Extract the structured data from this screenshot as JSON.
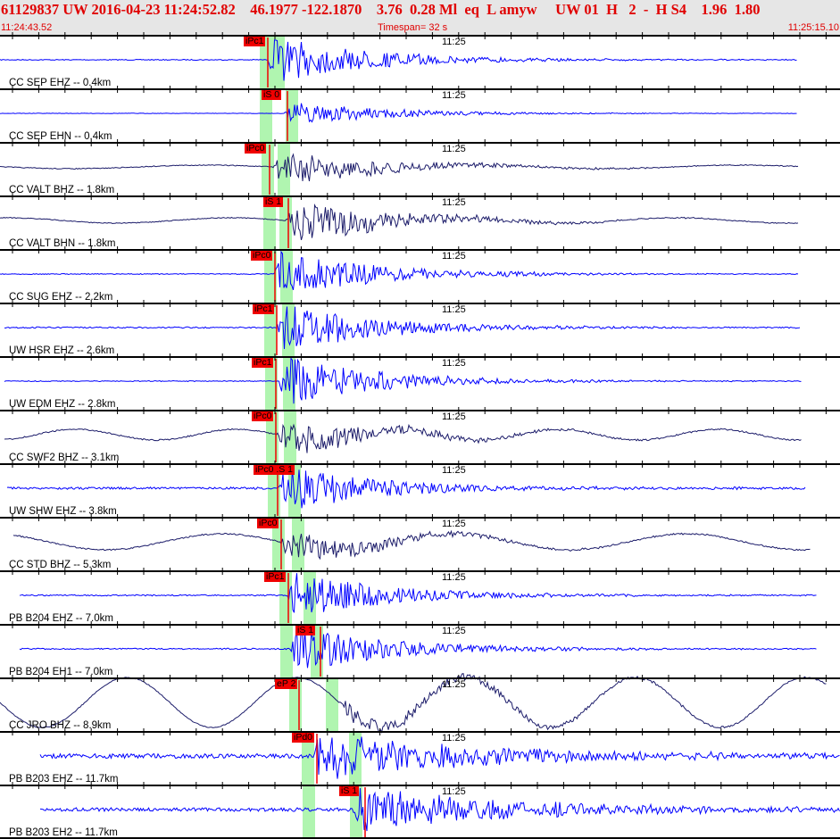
{
  "header": {
    "title": "61129837 UW 2016-04-23 11:24:52.82    46.1977 -122.1870    3.76  0.28 Ml  eq  L amyw     UW 01  H   2  -  H S4    1.96  1.80",
    "start_time": "11:24:43.52",
    "timespan": "Timespan=  32 s",
    "end_time": "11:25:15.10"
  },
  "minute_label": "11:25",
  "colors": {
    "short_period": "#0000ff",
    "broadband": "#1c1c6a",
    "pick": "#f00000",
    "window": "#b0f5b0"
  },
  "traces": [
    {
      "label": "CC SEP EHZ -- 0.4km",
      "pick": "iPc1"
    },
    {
      "label": "CC SEP EHN -- 0.4km",
      "pick": "iS 0"
    },
    {
      "label": "CC VALT BHZ -- 1.8km",
      "pick": "iPc0"
    },
    {
      "label": "CC VALT BHN -- 1.8km",
      "pick": "iS 1"
    },
    {
      "label": "CC SUG EHZ -- 2.2km",
      "pick": "iPc0"
    },
    {
      "label": "UW HSR EHZ -- 2.6km",
      "pick": "iPc1"
    },
    {
      "label": "UW EDM EHZ -- 2.8km",
      "pick": "iPc1"
    },
    {
      "label": "CC SWF2 BHZ -- 3.1km",
      "pick": "iPc0"
    },
    {
      "label": "UW SHW EHZ -- 3.8km",
      "pick": "iPc0 .S 1"
    },
    {
      "label": "CC STD BHZ -- 5.3km",
      "pick": "iPc0"
    },
    {
      "label": "PB B204 EHZ -- 7.0km",
      "pick": "iPc1"
    },
    {
      "label": "PB B204 EH1 -- 7.0km",
      "pick": "iS 1"
    },
    {
      "label": "CC JRO BHZ -- 8.9km",
      "pick": "eP 2"
    },
    {
      "label": "PB B203 EHZ -- 11.7km",
      "pick": "iPd0"
    },
    {
      "label": "PB B203 EH2 -- 11.7km",
      "pick": "iS 1"
    }
  ]
}
